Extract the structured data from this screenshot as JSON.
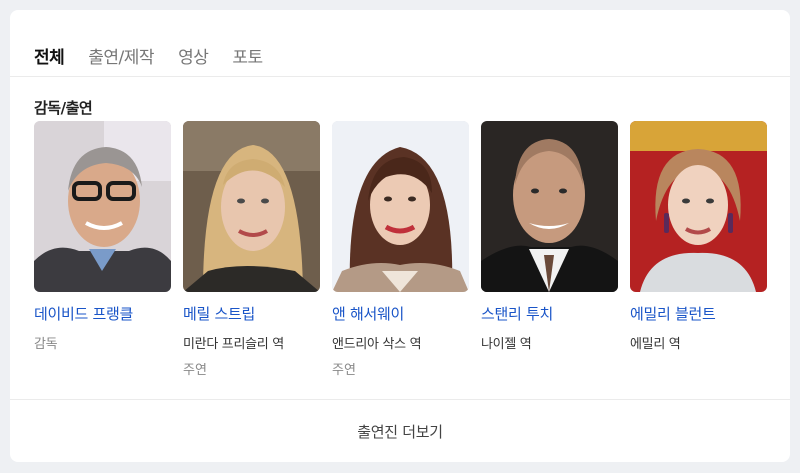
{
  "tabs": [
    {
      "label": "전체",
      "active": true
    },
    {
      "label": "출연/제작",
      "active": false
    },
    {
      "label": "영상",
      "active": false
    },
    {
      "label": "포토",
      "active": false
    }
  ],
  "section_title": "감독/출연",
  "people": [
    {
      "name": "데이비드 프랭클",
      "role": "감독",
      "sub": ""
    },
    {
      "name": "메릴 스트립",
      "role": "미란다 프리슬리 역",
      "sub": "주연"
    },
    {
      "name": "앤 해서웨이",
      "role": "앤드리아 삭스 역",
      "sub": "주연"
    },
    {
      "name": "스탠리 투치",
      "role": "나이젤 역",
      "sub": ""
    },
    {
      "name": "에밀리 블런트",
      "role": "에밀리 역",
      "sub": ""
    }
  ],
  "more_label": "출연진 더보기",
  "colors": {
    "link": "#1a55c8",
    "background": "#eef0f3",
    "card": "#ffffff"
  }
}
